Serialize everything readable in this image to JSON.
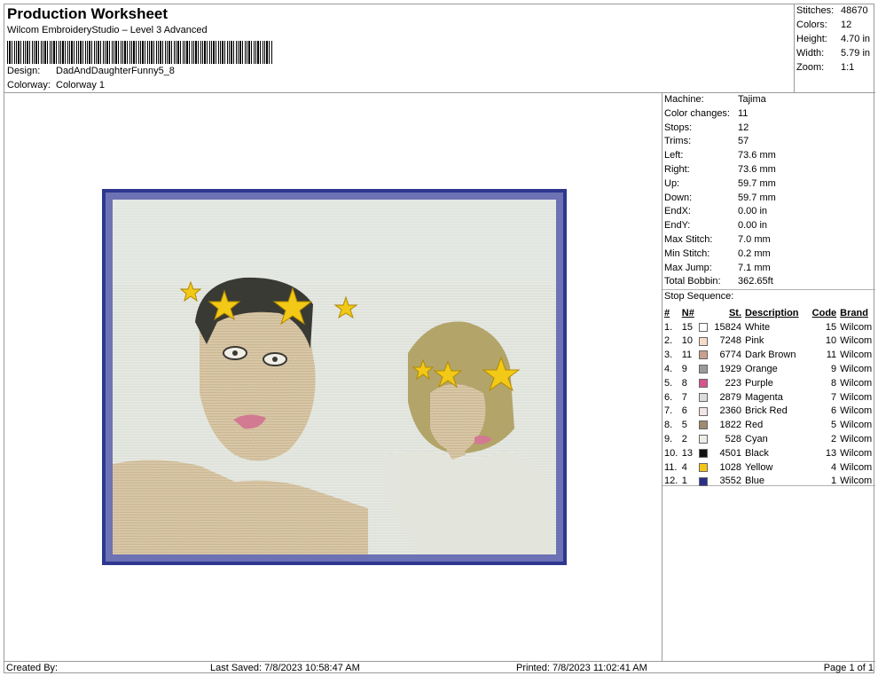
{
  "header": {
    "title": "Production Worksheet",
    "subtitle": "Wilcom EmbroideryStudio – Level 3 Advanced",
    "design_label": "Design:",
    "design_value": "DadAndDaughterFunny5_8",
    "colorway_label": "Colorway:",
    "colorway_value": "Colorway 1"
  },
  "stats": [
    {
      "k": "Stitches:",
      "v": "48670"
    },
    {
      "k": "Colors:",
      "v": "12"
    },
    {
      "k": "Height:",
      "v": "4.70 in"
    },
    {
      "k": "Width:",
      "v": "5.79 in"
    },
    {
      "k": "Zoom:",
      "v": "1:1"
    }
  ],
  "machine": [
    {
      "k": "Machine:",
      "v": "Tajima"
    },
    {
      "k": "Color changes:",
      "v": "11"
    },
    {
      "k": "Stops:",
      "v": "12"
    },
    {
      "k": "Trims:",
      "v": "57"
    },
    {
      "k": "Left:",
      "v": "73.6 mm"
    },
    {
      "k": "Right:",
      "v": "73.6 mm"
    },
    {
      "k": "Up:",
      "v": "59.7 mm"
    },
    {
      "k": "Down:",
      "v": "59.7 mm"
    },
    {
      "k": "EndX:",
      "v": "0.00 in"
    },
    {
      "k": "EndY:",
      "v": "0.00 in"
    },
    {
      "k": "Max Stitch:",
      "v": "7.0 mm"
    },
    {
      "k": "Min Stitch:",
      "v": "0.2 mm"
    },
    {
      "k": "Max Jump:",
      "v": "7.1 mm"
    },
    {
      "k": "Total Bobbin:",
      "v": "362.65ft"
    }
  ],
  "stop_sequence": {
    "title": "Stop Sequence:",
    "headers": {
      "num": "#",
      "n": "N#",
      "st": "St.",
      "desc": "Description",
      "code": "Code",
      "brand": "Brand"
    },
    "rows": [
      {
        "num": "1.",
        "n": "15",
        "color": "#ffffff",
        "st": "15824",
        "desc": "White",
        "code": "15",
        "brand": "Wilcom"
      },
      {
        "num": "2.",
        "n": "10",
        "color": "#f6dcc8",
        "st": "7248",
        "desc": "Pink",
        "code": "10",
        "brand": "Wilcom"
      },
      {
        "num": "3.",
        "n": "11",
        "color": "#c9a08f",
        "st": "6774",
        "desc": "Dark Brown",
        "code": "11",
        "brand": "Wilcom"
      },
      {
        "num": "4.",
        "n": "9",
        "color": "#9a9a9a",
        "st": "1929",
        "desc": "Orange",
        "code": "9",
        "brand": "Wilcom"
      },
      {
        "num": "5.",
        "n": "8",
        "color": "#d9548e",
        "st": "223",
        "desc": "Purple",
        "code": "8",
        "brand": "Wilcom"
      },
      {
        "num": "6.",
        "n": "7",
        "color": "#dcdcdc",
        "st": "2879",
        "desc": "Magenta",
        "code": "7",
        "brand": "Wilcom"
      },
      {
        "num": "7.",
        "n": "6",
        "color": "#f3e6e6",
        "st": "2360",
        "desc": "Brick Red",
        "code": "6",
        "brand": "Wilcom"
      },
      {
        "num": "8.",
        "n": "5",
        "color": "#a08a70",
        "st": "1822",
        "desc": "Red",
        "code": "5",
        "brand": "Wilcom"
      },
      {
        "num": "9.",
        "n": "2",
        "color": "#eeeee6",
        "st": "528",
        "desc": "Cyan",
        "code": "2",
        "brand": "Wilcom"
      },
      {
        "num": "10.",
        "n": "13",
        "color": "#111111",
        "st": "4501",
        "desc": "Black",
        "code": "13",
        "brand": "Wilcom"
      },
      {
        "num": "11.",
        "n": "4",
        "color": "#f4c514",
        "st": "1028",
        "desc": "Yellow",
        "code": "4",
        "brand": "Wilcom"
      },
      {
        "num": "12.",
        "n": "1",
        "color": "#2a2f8a",
        "st": "3552",
        "desc": "Blue",
        "code": "1",
        "brand": "Wilcom"
      }
    ]
  },
  "footer": {
    "created": "Created By:",
    "saved": "Last Saved: 7/8/2023 10:58:47 AM",
    "printed": "Printed: 7/8/2023 11:02:41 AM",
    "page": "Page 1 of 1"
  }
}
